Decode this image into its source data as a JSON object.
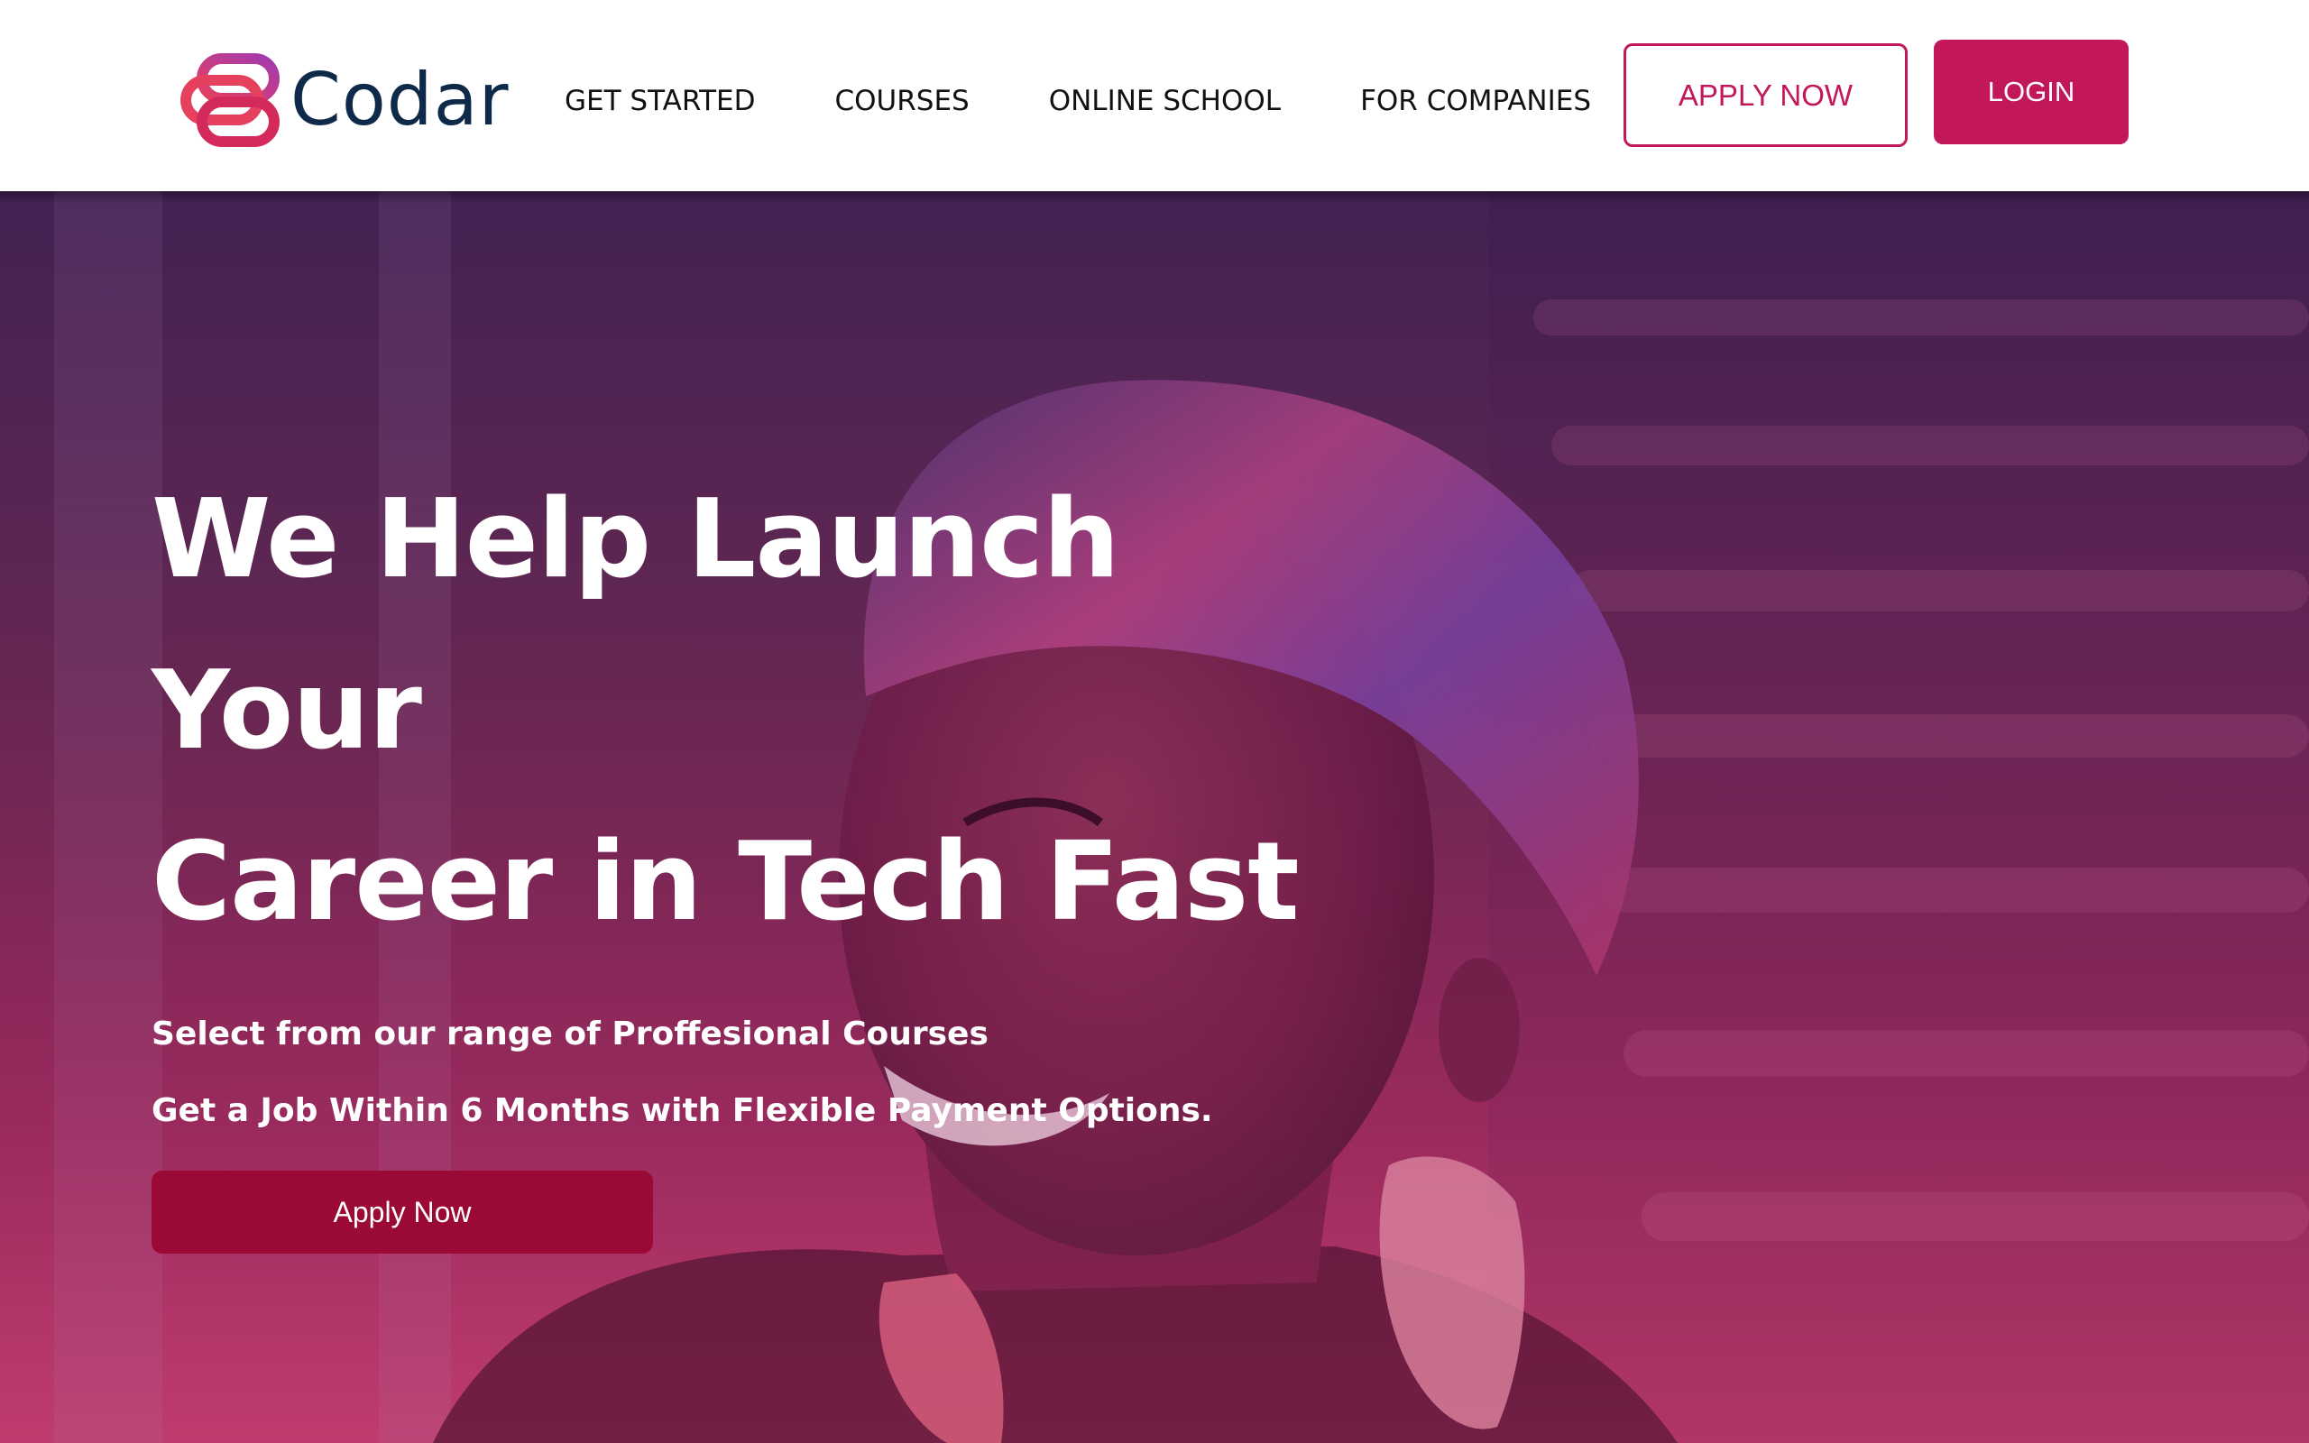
{
  "brand": {
    "name": "Codar",
    "logo_icon": "codar-logo-icon",
    "text_color": "#0f2a48",
    "gradient": [
      "#c2185b",
      "#e6405f",
      "#a23ab0"
    ]
  },
  "nav": {
    "items": [
      {
        "label": "GET STARTED"
      },
      {
        "label": "COURSES"
      },
      {
        "label": "ONLINE SCHOOL"
      },
      {
        "label": "FOR COMPANIES"
      }
    ]
  },
  "header": {
    "apply_label": "APPLY NOW",
    "login_label": "LOGIN"
  },
  "hero": {
    "title_line1": "We Help Launch Your",
    "title_line2": "Career in Tech Fast",
    "subtitle1": "Select from our range of Proffesional Courses",
    "subtitle2": "Get a Job Within 6 Months with Flexible Payment Options.",
    "cta_label": "Apply Now",
    "image": "smiling-woman-photo"
  },
  "colors": {
    "accent": "#c2185b",
    "cta_dark": "#9b0a36",
    "overlay_top": "#3f2451",
    "overlay_bottom": "#bc3c6f"
  }
}
